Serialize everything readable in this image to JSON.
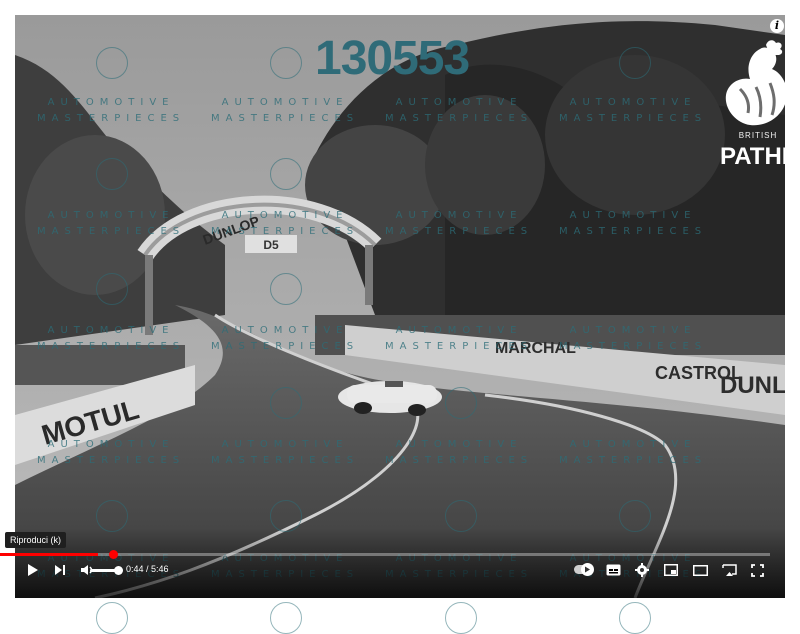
{
  "video": {
    "id_overlay": "130553",
    "info_glyph": "i"
  },
  "watermark": {
    "line1": "AUTOMOTIVE",
    "line2": "MASTERPIECES"
  },
  "pathe_logo": {
    "small_text": "BRITISH",
    "brand_text": "PATHÉ"
  },
  "player": {
    "tooltip": "Riproduci (k)",
    "time_current": "0:44",
    "time_separator": " / ",
    "time_total": "5:46",
    "progress_fraction": 0.127,
    "volume_fraction": 1.0,
    "icons": [
      "play-icon",
      "next-icon",
      "volume-icon",
      "autoplay-toggle",
      "subtitles-icon",
      "settings-icon",
      "miniplayer-icon",
      "theater-icon",
      "cast-icon",
      "fullscreen-icon"
    ]
  },
  "scene_signs": {
    "arch_text": "DUNLOP",
    "arch_tag": "D5",
    "left_banner": "MOTUL",
    "right_banner_1": "MARCHAL",
    "right_banner_2": "CASTROL",
    "right_banner_3": "DUNLO"
  },
  "colors": {
    "watermark": "#2c6d78",
    "progress": "#ff0000"
  }
}
